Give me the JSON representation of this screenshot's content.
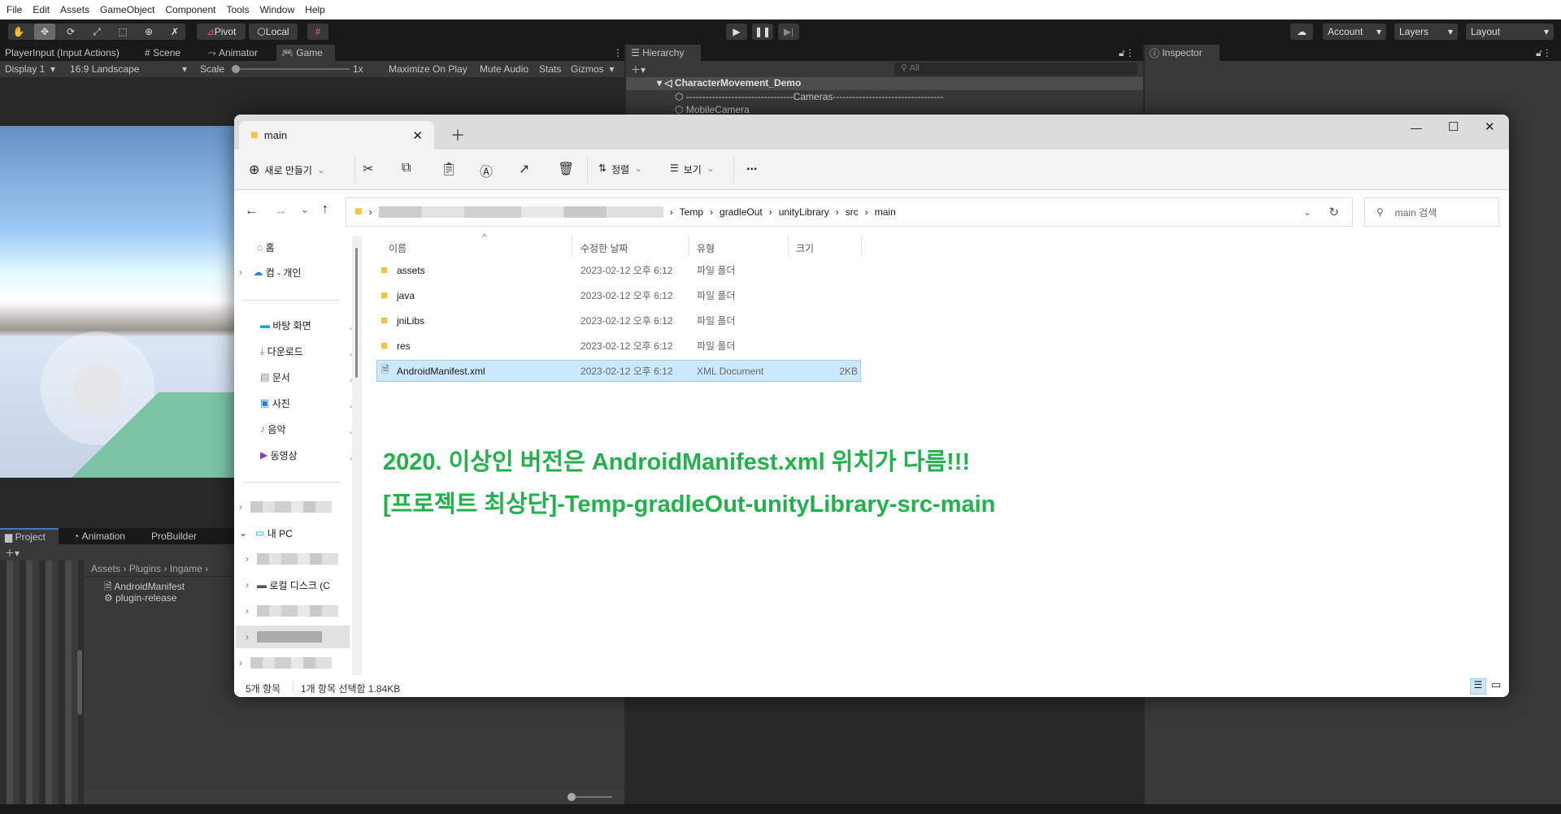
{
  "menu": [
    "File",
    "Edit",
    "Assets",
    "GameObject",
    "Component",
    "Tools",
    "Window",
    "Help"
  ],
  "toolbar": {
    "pivot": "Pivot",
    "local": "Local",
    "account": "Account",
    "layers": "Layers",
    "layout": "Layout"
  },
  "game_panel": {
    "tabs": [
      "PlayerInput (Input Actions)",
      "Scene",
      "Animator",
      "Game"
    ],
    "display": "Display 1",
    "aspect": "16:9 Landscape",
    "scale_label": "Scale",
    "scale_value": "1x",
    "maximize": "Maximize On Play",
    "mute": "Mute Audio",
    "stats": "Stats",
    "gizmos": "Gizmos"
  },
  "hierarchy": {
    "tab": "Hierarchy",
    "search_placeholder": "All",
    "scene": "CharacterMovement_Demo",
    "items": [
      "---------------------------------Cameras----------------------------------",
      "MobileCamera"
    ]
  },
  "inspector": {
    "tab": "Inspector"
  },
  "project_panel": {
    "tabs": [
      "Project",
      "Animation",
      "ProBuilder"
    ],
    "breadcrumb": [
      "Assets",
      "Plugins",
      "Ingame"
    ],
    "items": [
      "AndroidManifest",
      "plugin-release"
    ]
  },
  "explorer": {
    "tab_title": "main",
    "commands": {
      "new": "새로 만들기",
      "sort": "정렬",
      "view": "보기",
      "more": "..."
    },
    "address": [
      "Temp",
      "gradleOut",
      "unityLibrary",
      "src",
      "main"
    ],
    "search_placeholder": "main 검색",
    "nav": {
      "home": "홈",
      "cloud": "컴 - 개인",
      "desktop": "바탕 화면",
      "downloads": "다운로드",
      "documents": "문서",
      "pictures": "사진",
      "music": "음악",
      "videos": "동영상",
      "this_pc": "내 PC",
      "local_disk": "로컬 디스크 (C"
    },
    "columns": [
      "이름",
      "수정한 날짜",
      "유형",
      "크기"
    ],
    "files": [
      {
        "name": "assets",
        "date": "2023-02-12 오후 6:12",
        "type": "파일 폴더",
        "size": "",
        "icon": "folder-icon"
      },
      {
        "name": "java",
        "date": "2023-02-12 오후 6:12",
        "type": "파일 폴더",
        "size": "",
        "icon": "folder-icon"
      },
      {
        "name": "jniLibs",
        "date": "2023-02-12 오후 6:12",
        "type": "파일 폴더",
        "size": "",
        "icon": "folder-icon"
      },
      {
        "name": "res",
        "date": "2023-02-12 오후 6:12",
        "type": "파일 폴더",
        "size": "",
        "icon": "folder-icon"
      },
      {
        "name": "AndroidManifest.xml",
        "date": "2023-02-12 오후 6:12",
        "type": "XML Document",
        "size": "2KB",
        "icon": "xml-file-icon",
        "selected": true
      }
    ],
    "status": {
      "count": "5개 항목",
      "selected": "1개 항목 선택함 1.84KB"
    },
    "annotation": [
      "2020. 이상인 버전은 AndroidManifest.xml 위치가 다름!!!",
      "[프로젝트 최상단]-Temp-gradleOut-unityLibrary-src-main"
    ],
    "annotation_color": "#22b24c"
  }
}
